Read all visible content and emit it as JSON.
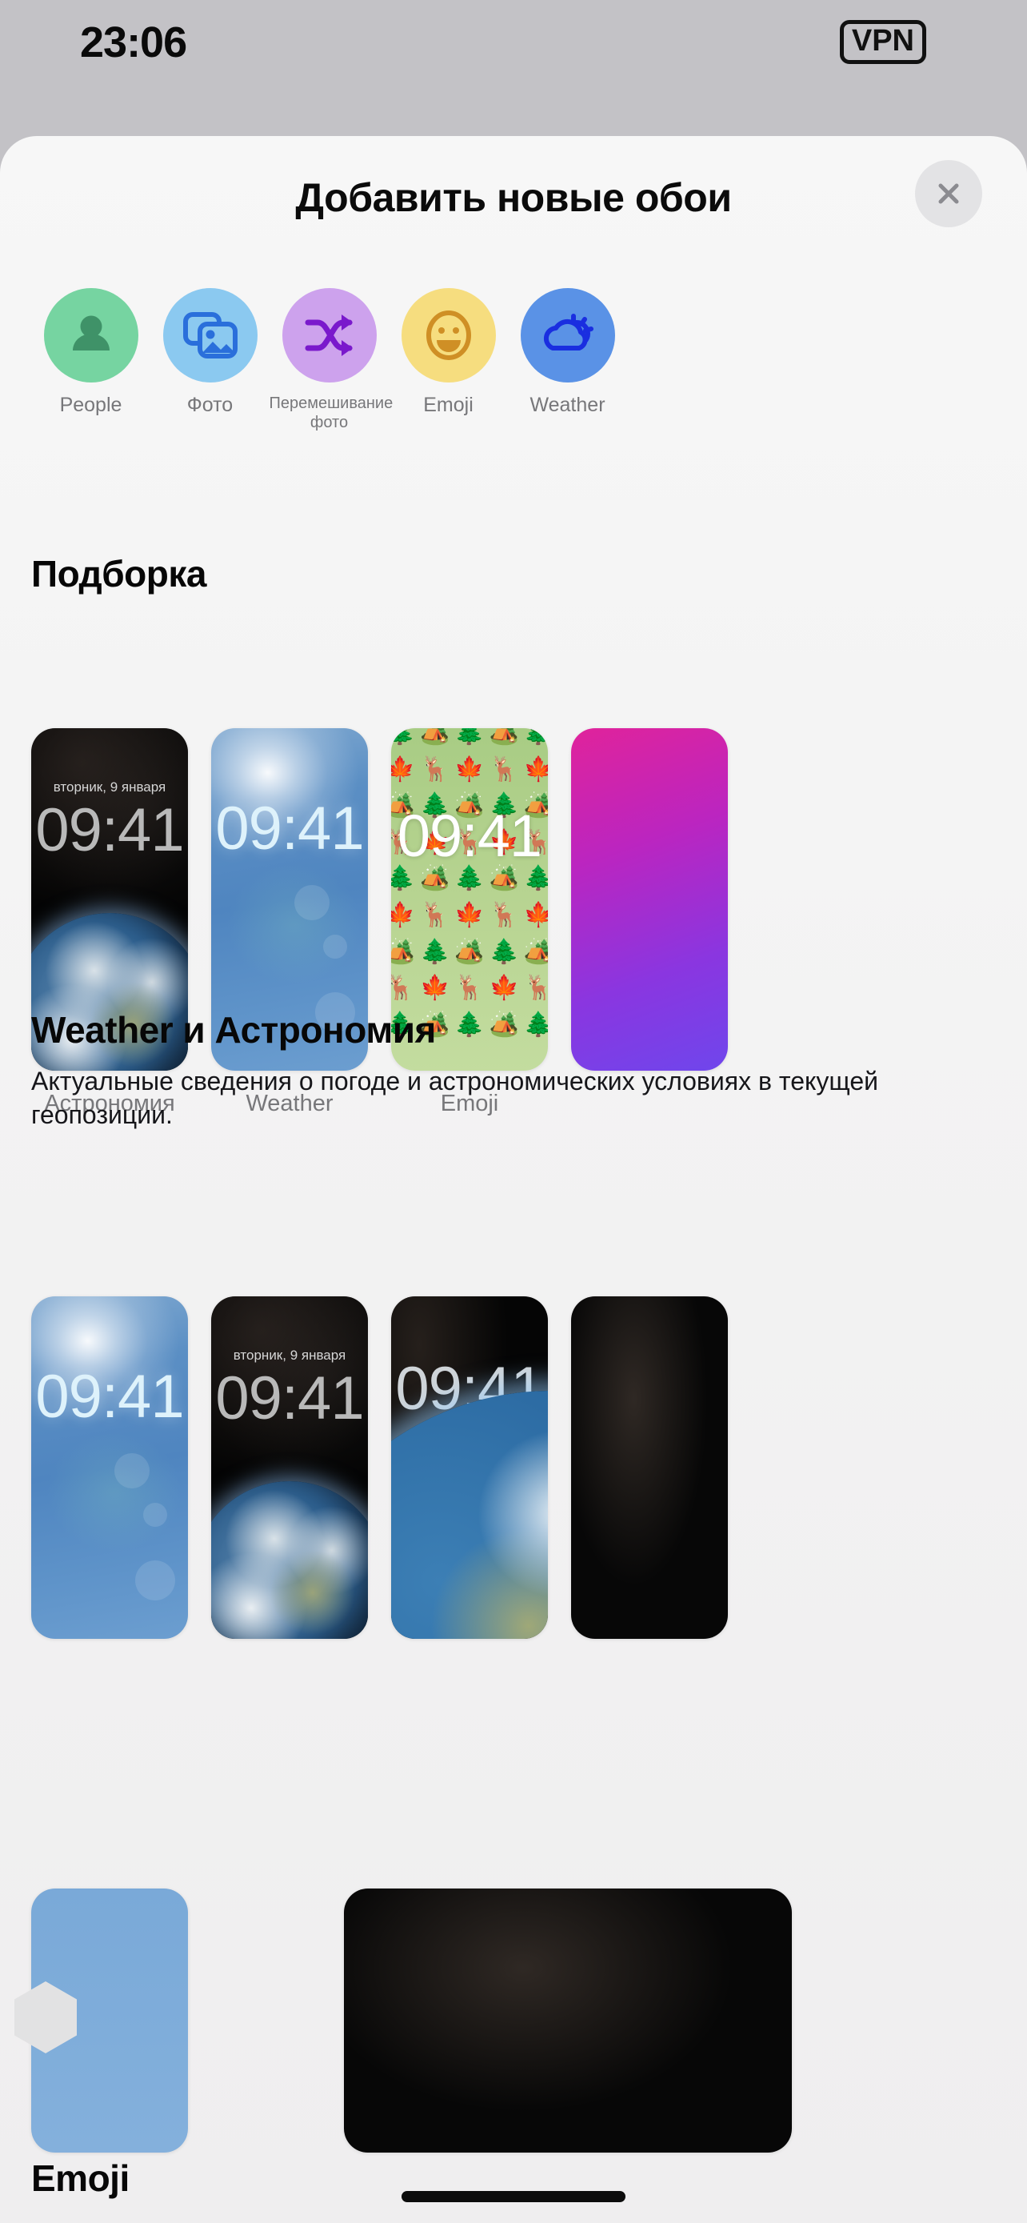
{
  "status_bar": {
    "time": "23:06",
    "vpn_label": "VPN"
  },
  "sheet": {
    "title": "Добавить новые обои",
    "close_icon": "close-icon"
  },
  "categories": [
    {
      "label": "People",
      "icon": "person-icon",
      "circle_color": "#76d4a1",
      "icon_color": "#3f9268"
    },
    {
      "label": "Фото",
      "icon": "photos-icon",
      "circle_color": "#8bc9f0",
      "icon_color": "#2a6fdb"
    },
    {
      "label": "Перемешивание фото",
      "icon": "shuffle-icon",
      "circle_color": "#cda2ed",
      "icon_color": "#7a19cc"
    },
    {
      "label": "Emoji",
      "icon": "smiley-icon",
      "circle_color": "#f6dd7f",
      "icon_color": "#cf8f25"
    },
    {
      "label": "Weather",
      "icon": "weather-icon",
      "circle_color": "#5a92e6",
      "icon_color": "#1a2ee0"
    }
  ],
  "sections": [
    {
      "title": "Подборка",
      "description": "",
      "items": [
        {
          "label": "Астрономия",
          "kind": "astronomy",
          "clock": "09:41",
          "date": "вторник, 9 января"
        },
        {
          "label": "Weather",
          "kind": "weather",
          "clock": "09:41",
          "date": ""
        },
        {
          "label": "Emoji",
          "kind": "emoji",
          "clock": "09:41",
          "date": ""
        },
        {
          "label": "",
          "kind": "purple",
          "clock": "",
          "date": ""
        }
      ]
    },
    {
      "title": "Weather и Астрономия",
      "description": "Актуальные сведения о погоде и астрономических условиях в текущей геопозиции.",
      "items": [
        {
          "label": "",
          "kind": "weather",
          "clock": "09:41",
          "date": ""
        },
        {
          "label": "",
          "kind": "astronomy",
          "clock": "09:41",
          "date": "вторник, 9 января"
        },
        {
          "label": "",
          "kind": "earth",
          "clock": "09:41",
          "date": ""
        },
        {
          "label": "",
          "kind": "stars",
          "clock": "",
          "date": ""
        }
      ]
    },
    {
      "title": "Emoji",
      "description": "",
      "items": []
    }
  ],
  "emoji_pattern": [
    "🌲",
    "🏕️",
    "🌲",
    "🏕️",
    "🌲",
    "🍁",
    "🦌",
    "🍁",
    "🦌",
    "🍁",
    "🏕️",
    "🌲",
    "🏕️",
    "🌲",
    "🏕️",
    "🦌",
    "🍁",
    "🦌",
    "🍁",
    "🦌",
    "🌲",
    "🏕️",
    "🌲",
    "🏕️",
    "🌲",
    "🍁",
    "🦌",
    "🍁",
    "🦌",
    "🍁",
    "🏕️",
    "🌲",
    "🏕️",
    "🌲",
    "🏕️",
    "🦌",
    "🍁",
    "🦌",
    "🍁",
    "🦌",
    "🌲",
    "🏕️",
    "🌲",
    "🏕️",
    "🌲"
  ],
  "colors": {
    "sheet_background": "#f5f5f5",
    "page_background": "#c3c2c6",
    "label_gray": "#77777a",
    "heading_black": "#070707"
  }
}
